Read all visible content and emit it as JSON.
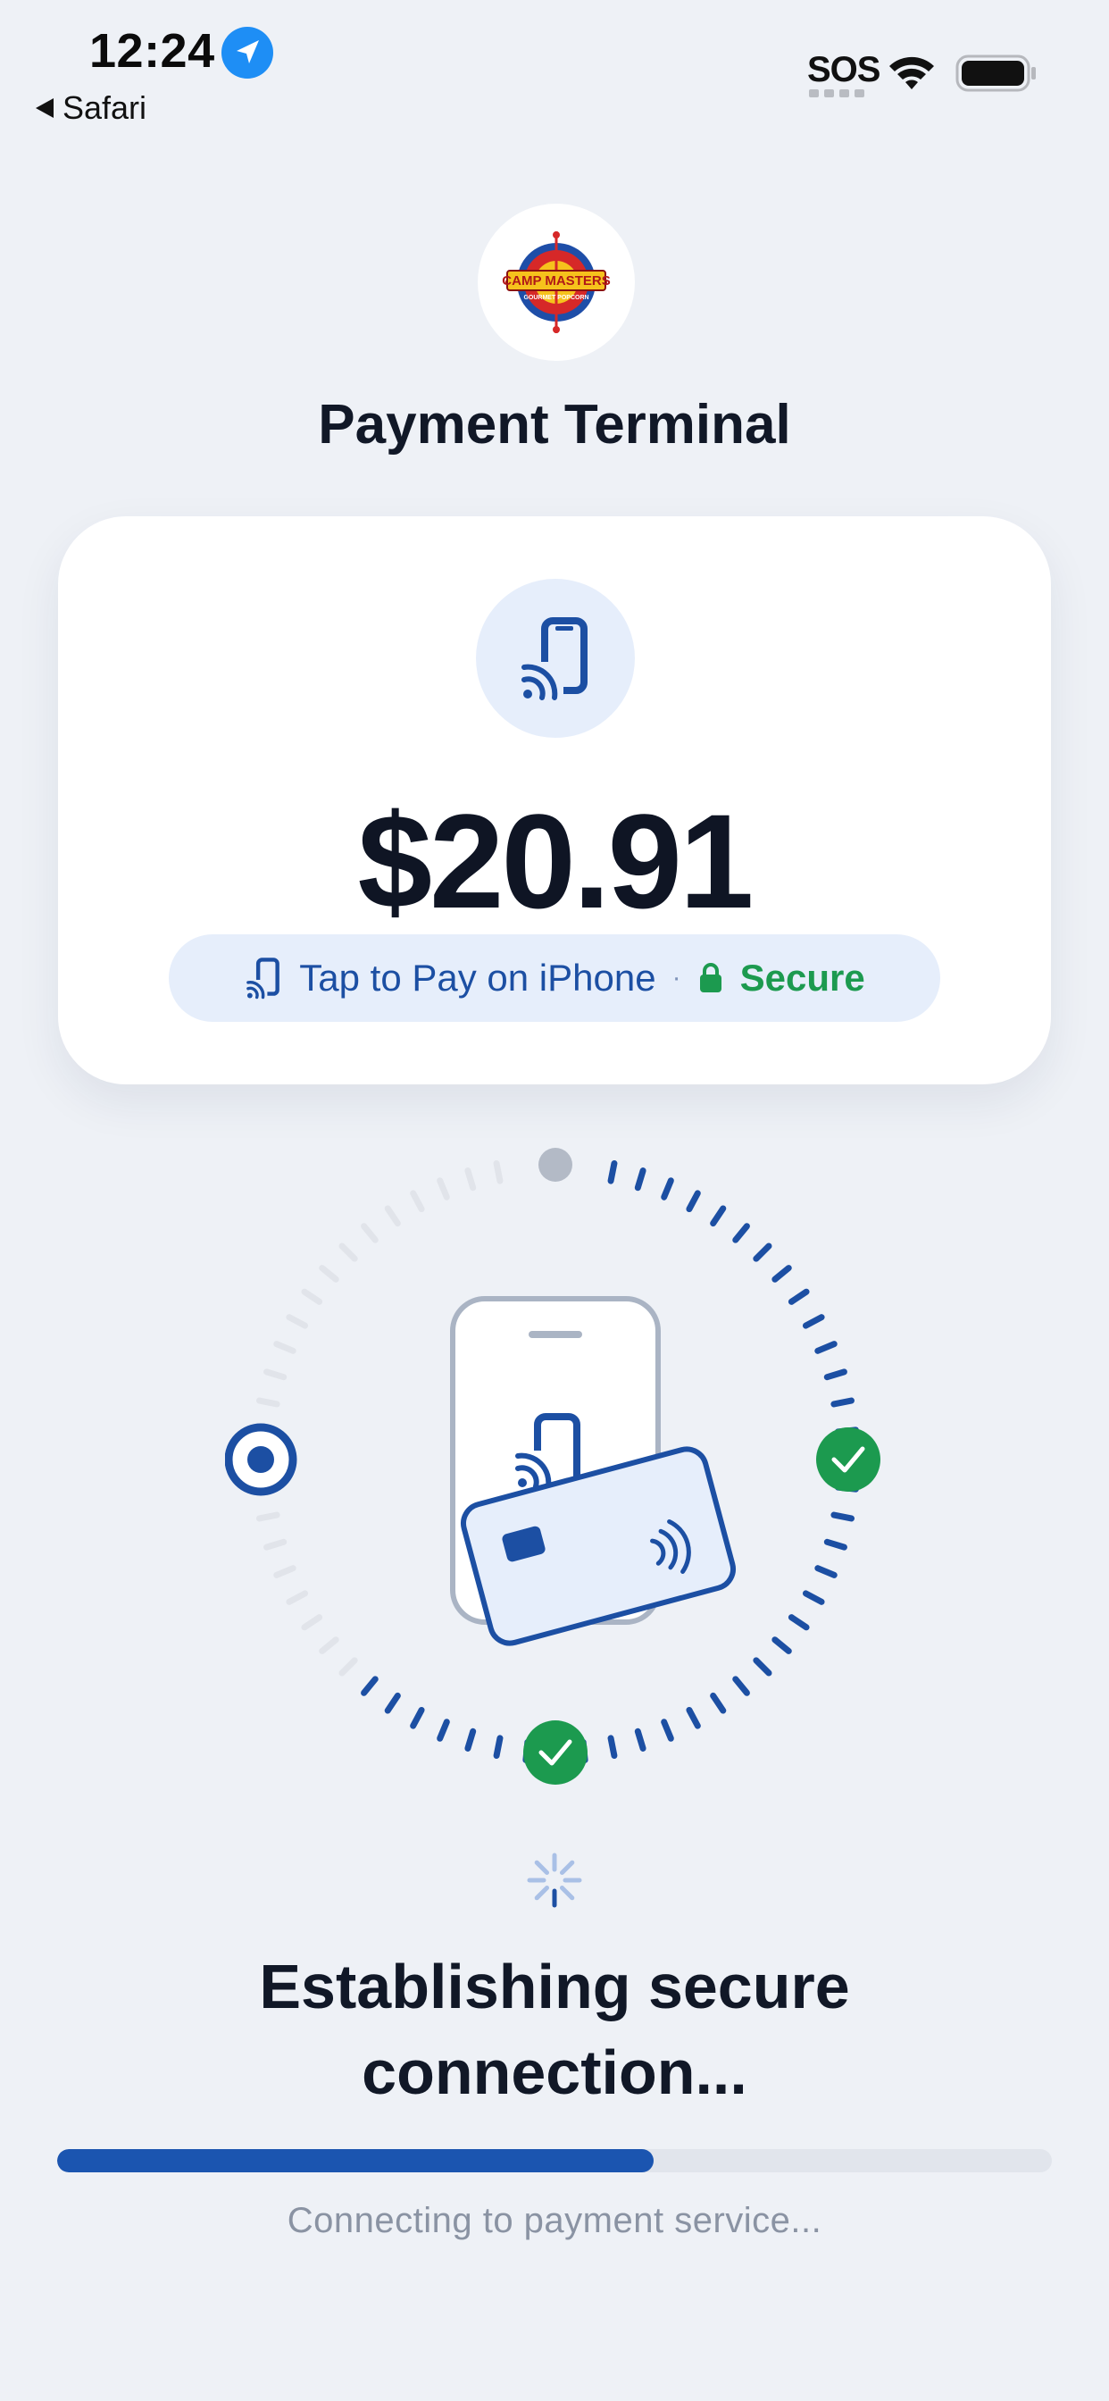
{
  "status_bar": {
    "time": "12:24",
    "back_label": "Safari",
    "sos": "SOS",
    "icons": [
      "location-arrow-icon",
      "wifi-icon",
      "battery-icon"
    ]
  },
  "header": {
    "logo_name": "Camp Masters Gourmet Popcorn logo",
    "logo_text": "CAMP MASTERS",
    "logo_subtext": "GOURMET POPCORN",
    "title": "Payment Terminal"
  },
  "card": {
    "icon": "tap-to-pay-phone-icon",
    "amount": "$20.91",
    "method_label": "Tap to Pay on iPhone",
    "separator": "·",
    "secure_label": "Secure"
  },
  "progress_ring": {
    "icons": [
      "target-icon",
      "phone-icon",
      "credit-card-icon",
      "checkmark-icon"
    ],
    "steps": [
      {
        "position": "top",
        "state": "pending"
      },
      {
        "position": "right",
        "state": "complete"
      },
      {
        "position": "bottom",
        "state": "complete"
      },
      {
        "position": "left",
        "state": "active"
      }
    ]
  },
  "status": {
    "title_line1": "Establishing secure",
    "title_line2": "connection...",
    "progress": 0.6,
    "subtitle": "Connecting to payment service..."
  },
  "colors": {
    "background": "#eef1f6",
    "accent": "#1b55b0",
    "success": "#1c9a4f",
    "pending": "#b3bac6"
  }
}
